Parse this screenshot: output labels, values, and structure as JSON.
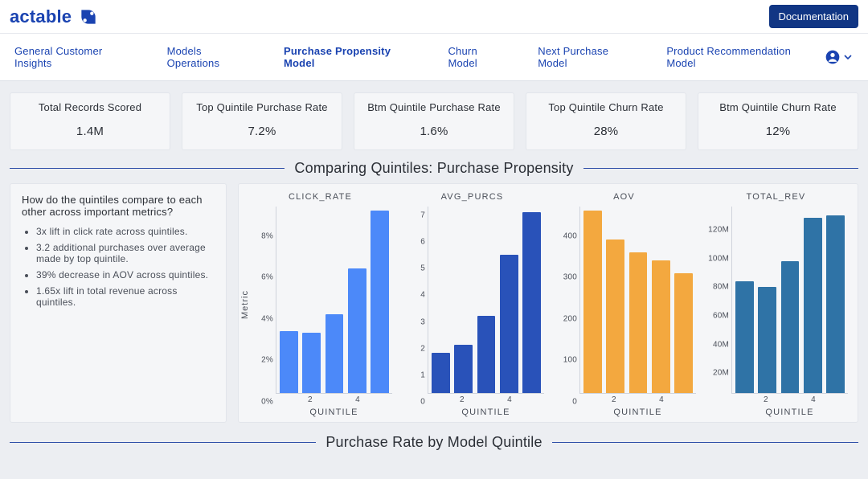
{
  "brand": "actable",
  "header": {
    "doc_btn": "Documentation"
  },
  "nav": {
    "tabs": [
      "General Customer Insights",
      "Models Operations",
      "Purchase Propensity Model",
      "Churn Model",
      "Next Purchase Model",
      "Product Recommendation Model"
    ],
    "active_index": 2
  },
  "kpis": [
    {
      "label": "Total Records Scored",
      "value": "1.4M"
    },
    {
      "label": "Top Quintile Purchase Rate",
      "value": "7.2%"
    },
    {
      "label": "Btm Quintile Purchase Rate",
      "value": "1.6%"
    },
    {
      "label": "Top Quintile Churn Rate",
      "value": "28%"
    },
    {
      "label": "Btm Quintile Churn Rate",
      "value": "12%"
    }
  ],
  "section1_title": "Comparing Quintiles: Purchase Propensity",
  "note": {
    "question": "How do the quintiles compare to each other across important metrics?",
    "bullets": [
      "3x lift in click rate across quintiles.",
      "3.2 additional purchases over average made by top quintile.",
      "39% decrease in AOV across quintiles.",
      "1.65x lift in total revenue across quintiles."
    ]
  },
  "section2_title": "Purchase Rate by Model Quintile",
  "chart_common": {
    "x_ticks": [
      "2",
      "4"
    ],
    "x_label": "QUINTILE",
    "y_axis_label": "Metric"
  },
  "chart_data": [
    {
      "type": "bar",
      "title": "CLICK_RATE",
      "categories": [
        1,
        2,
        3,
        4,
        5
      ],
      "values": [
        3.0,
        2.9,
        3.8,
        6.0,
        8.8
      ],
      "ylim": [
        0,
        9
      ],
      "y_ticks": [
        "0%",
        "2%",
        "4%",
        "6%",
        "8%"
      ],
      "color": "#4c89f9",
      "xlabel": "QUINTILE",
      "ylabel": "Metric"
    },
    {
      "type": "bar",
      "title": "AVG_PURCS",
      "categories": [
        1,
        2,
        3,
        4,
        5
      ],
      "values": [
        1.5,
        1.8,
        2.9,
        5.2,
        6.8
      ],
      "ylim": [
        0,
        7
      ],
      "y_ticks": [
        "0",
        "1",
        "2",
        "3",
        "4",
        "5",
        "6",
        "7"
      ],
      "color": "#2952b9",
      "xlabel": "QUINTILE",
      "ylabel": "Metric"
    },
    {
      "type": "bar",
      "title": "AOV",
      "categories": [
        1,
        2,
        3,
        4,
        5
      ],
      "values": [
        440,
        370,
        340,
        320,
        290
      ],
      "ylim": [
        0,
        450
      ],
      "y_ticks": [
        "0",
        "100",
        "200",
        "300",
        "400"
      ],
      "color": "#f3a83f",
      "xlabel": "QUINTILE",
      "ylabel": "Metric"
    },
    {
      "type": "bar",
      "title": "TOTAL_REV",
      "categories": [
        1,
        2,
        3,
        4,
        5
      ],
      "values": [
        78000000,
        74000000,
        92000000,
        122000000,
        124000000
      ],
      "ylim": [
        0,
        130000000
      ],
      "y_ticks": [
        "20M",
        "40M",
        "60M",
        "80M",
        "100M",
        "120M"
      ],
      "y_tick_values": [
        20000000,
        40000000,
        60000000,
        80000000,
        100000000,
        120000000
      ],
      "color": "#2f73a6",
      "xlabel": "QUINTILE",
      "ylabel": "Metric"
    }
  ]
}
